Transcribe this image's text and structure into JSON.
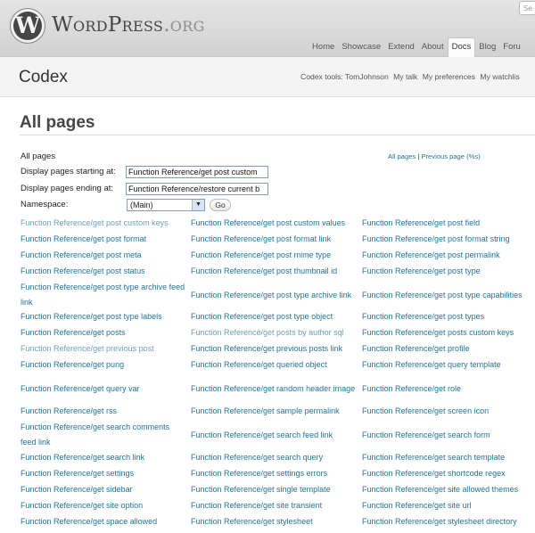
{
  "header": {
    "logo_letter": "W",
    "wordmark_main": "WordPress",
    "wordmark_suffix": ".org",
    "search_placeholder": "Se",
    "nav": [
      "Home",
      "Showcase",
      "Extend",
      "About",
      "Docs",
      "Blog",
      "Foru"
    ],
    "active_nav": "Docs"
  },
  "codex": {
    "title": "Codex",
    "tools_label": "Codex tools: TomJohnson",
    "tools": [
      "My talk",
      "My preferences",
      "My watchlis"
    ]
  },
  "page": {
    "heading": "All pages",
    "form": {
      "all_pages_label": "All pages",
      "start_label": "Display pages starting at:",
      "start_value": "Function Reference/get post custom",
      "end_label": "Display pages ending at:",
      "end_value": "Function Reference/restore current b",
      "namespace_label": "Namespace:",
      "namespace_value": "(Main)",
      "go_label": "Go"
    },
    "top_links": {
      "all_pages": "All pages",
      "separator": " | ",
      "previous": "Previous page (%s)"
    }
  },
  "links": [
    [
      "Function Reference/get post custom keys",
      "Function Reference/get post custom values",
      "Function Reference/get post field"
    ],
    [
      "Function Reference/get post format",
      "Function Reference/get post format link",
      "Function Reference/get post format string"
    ],
    [
      "Function Reference/get post meta",
      "Function Reference/get post mime type",
      "Function Reference/get post permalink"
    ],
    [
      "Function Reference/get post status",
      "Function Reference/get post thumbnail id",
      "Function Reference/get post type"
    ],
    [
      "Function Reference/get post type archive feed link",
      "Function Reference/get post type archive link",
      "Function Reference/get post type capabilities"
    ],
    [
      "Function Reference/get post type labels",
      "Function Reference/get post type object",
      "Function Reference/get post types"
    ],
    [
      "Function Reference/get posts",
      "Function Reference/get posts by author sql",
      "Function Reference/get posts custom keys"
    ],
    [
      "Function Reference/get previous post",
      "Function Reference/get previous posts link",
      "Function Reference/get profile"
    ],
    [
      "Function Reference/get pung",
      "Function Reference/get queried object",
      "Function Reference/get query template"
    ],
    [
      "Function Reference/get query var",
      "Function Reference/get random header image",
      "Function Reference/get role"
    ],
    [
      "Function Reference/get rss",
      "Function Reference/get sample permalink",
      "Function Reference/get screen icon"
    ],
    [
      "Function Reference/get search comments feed link",
      "Function Reference/get search feed link",
      "Function Reference/get search form"
    ],
    [
      "Function Reference/get search link",
      "Function Reference/get search query",
      "Function Reference/get search template"
    ],
    [
      "Function Reference/get settings",
      "Function Reference/get settings errors",
      "Function Reference/get shortcode regex"
    ],
    [
      "Function Reference/get sidebar",
      "Function Reference/get single template",
      "Function Reference/get site allowed themes"
    ],
    [
      "Function Reference/get site option",
      "Function Reference/get site transient",
      "Function Reference/get site url"
    ],
    [
      "Function Reference/get space allowed",
      "Function Reference/get stylesheet",
      "Function Reference/get stylesheet directory"
    ]
  ],
  "visited_links": [
    "Function Reference/get post custom keys",
    "Function Reference/get posts by author sql",
    "Function Reference/get previous post"
  ],
  "colors": {
    "link": "#21759b",
    "visited_link": "#6fa0ba",
    "header_bg": "#d8d8d8"
  }
}
